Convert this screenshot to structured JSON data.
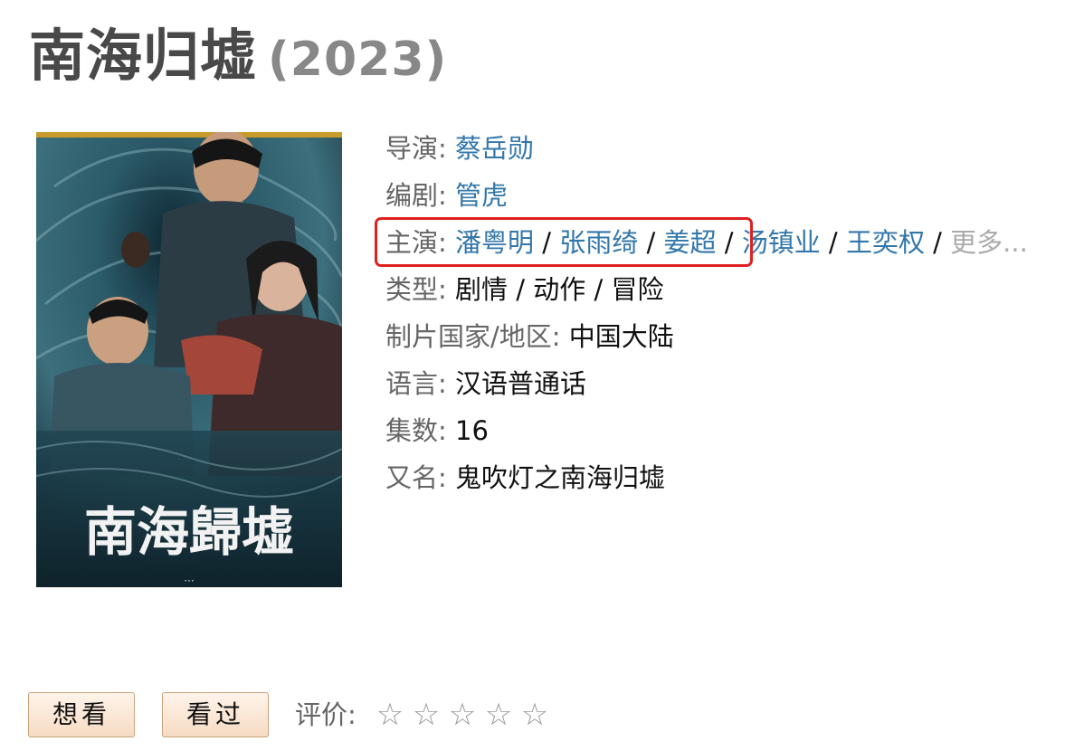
{
  "title": {
    "name": "南海归墟",
    "year": "(2023)"
  },
  "poster": {
    "alt_text": "南海歸墟",
    "colors": {
      "sea": "#2a4c58",
      "dark": "#0f2730"
    }
  },
  "info": {
    "director": {
      "label": "导演:",
      "names": [
        "蔡岳勋"
      ]
    },
    "writer": {
      "label": "编剧:",
      "names": [
        "管虎"
      ]
    },
    "cast": {
      "label": "主演:",
      "names": [
        "潘粤明",
        "张雨绮",
        "姜超",
        "汤镇业",
        "王奕权"
      ],
      "separator": " / ",
      "more": "更多..."
    },
    "genre": {
      "label": "类型:",
      "values": [
        "剧情",
        "动作",
        "冒险"
      ]
    },
    "country": {
      "label": "制片国家/地区:",
      "value": "中国大陆"
    },
    "language": {
      "label": "语言:",
      "value": "汉语普通话"
    },
    "episodes": {
      "label": "集数:",
      "value": "16"
    },
    "aka": {
      "label": "又名:",
      "value": "鬼吹灯之南海归墟"
    }
  },
  "actions": {
    "want_label": "想看",
    "seen_label": "看过",
    "rating_label": "评价:",
    "stars": [
      "☆",
      "☆",
      "☆",
      "☆",
      "☆"
    ]
  },
  "colors": {
    "link": "#3377aa",
    "highlight": "#e02020",
    "button_bg": "#f6dbc3"
  }
}
